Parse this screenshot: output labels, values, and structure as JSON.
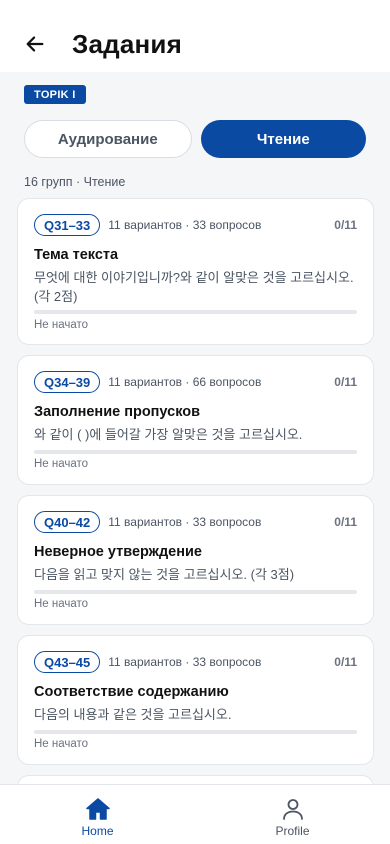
{
  "header": {
    "title": "Задания"
  },
  "level_badge": "TOPIK I",
  "tabs": [
    {
      "label": "Аудирование",
      "active": false
    },
    {
      "label": "Чтение",
      "active": true
    }
  ],
  "summary": "16 групп · Чтение",
  "cards": [
    {
      "range": "Q31–33",
      "meta": "11 вариантов · 33 вопросов",
      "score": "0/11",
      "title": "Тема текста",
      "description": "무엇에 대한 이야기입니까?와 같이 알맞은 것을 고르십시오.(각 2점)",
      "status": "Не начато",
      "progress": 0
    },
    {
      "range": "Q34–39",
      "meta": "11 вариантов · 66 вопросов",
      "score": "0/11",
      "title": "Заполнение пропусков",
      "description": "와 같이 ( )에 들어갈 가장 알맞은 것을 고르십시오.",
      "status": "Не начато",
      "progress": 0
    },
    {
      "range": "Q40–42",
      "meta": "11 вариантов · 33 вопросов",
      "score": "0/11",
      "title": "Неверное утверждение",
      "description": "다음을 읽고 맞지 않는 것을 고르십시오. (각 3점)",
      "status": "Не начато",
      "progress": 0
    },
    {
      "range": "Q43–45",
      "meta": "11 вариантов · 33 вопросов",
      "score": "0/11",
      "title": "Соответствие содержанию",
      "description": "다음의 내용과 같은 것을 고르십시오.",
      "status": "Не начато",
      "progress": 0
    }
  ],
  "bottom_nav": [
    {
      "label": "Home",
      "icon": "home-icon",
      "active": true
    },
    {
      "label": "Profile",
      "icon": "profile-icon",
      "active": false
    }
  ],
  "colors": {
    "accent": "#0b4aa2",
    "background": "#f5f6f8"
  }
}
